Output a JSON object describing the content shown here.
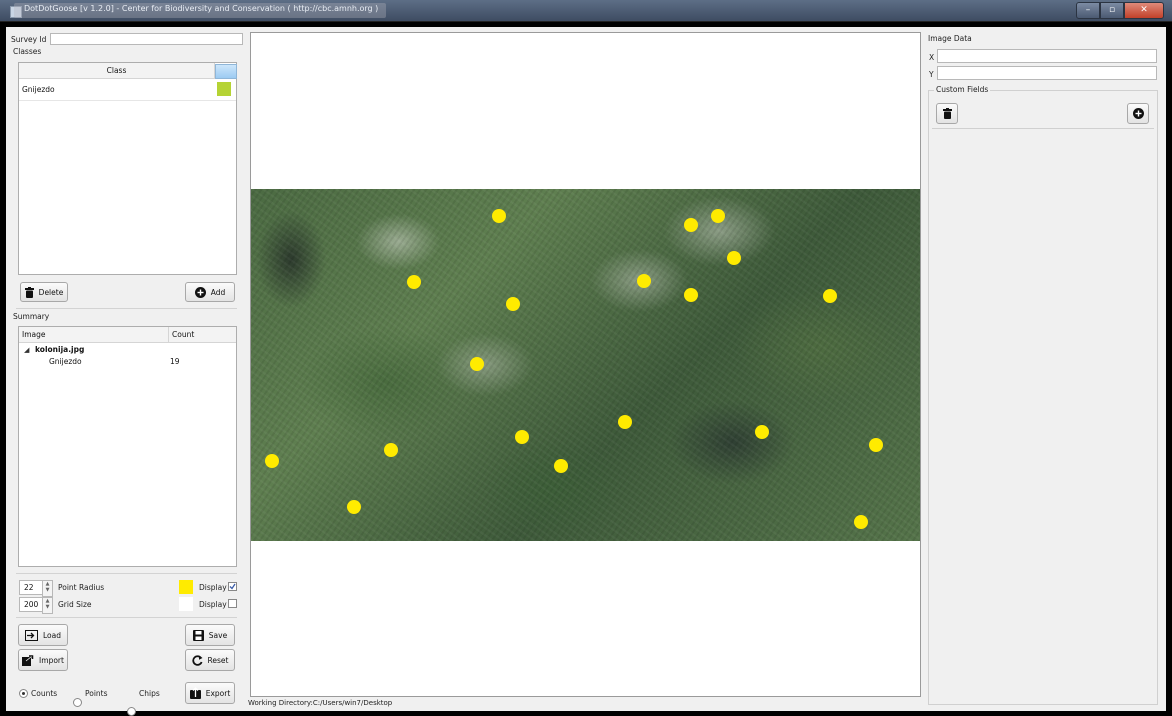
{
  "window": {
    "title": "DotDotGoose [v 1.2.0] - Center for Biodiversity and Conservation ( http://cbc.amnh.org )"
  },
  "left": {
    "survey_id_label": "Survey Id",
    "survey_id_value": "",
    "classes_label": "Classes",
    "classes_table": {
      "header": "Class",
      "rows": [
        {
          "name": "Gnijezdo",
          "color": "#b5d334"
        }
      ]
    },
    "delete_label": "Delete",
    "add_label": "Add",
    "summary_label": "Summary",
    "summary_table": {
      "headers": [
        "Image",
        "Count"
      ],
      "image_name": "kolonija.jpg",
      "rows": [
        {
          "class": "Gnijezdo",
          "count": "19"
        }
      ]
    },
    "point_radius_value": "22",
    "point_radius_label": "Point Radius",
    "point_color": "#ffeb00",
    "grid_size_value": "200",
    "grid_size_label": "Grid Size",
    "grid_color": "#ffffff",
    "display_label": "Display",
    "point_display_checked": true,
    "grid_display_checked": false,
    "load_label": "Load",
    "save_label": "Save",
    "import_label": "Import",
    "reset_label": "Reset",
    "export_label": "Export",
    "radio_options": [
      "Counts",
      "Points",
      "Chips"
    ],
    "radio_selected": "Counts"
  },
  "right": {
    "image_data_label": "Image Data",
    "x_label": "X",
    "y_label": "Y",
    "x_value": "",
    "y_value": "",
    "custom_fields_label": "Custom Fields"
  },
  "canvas": {
    "image_file": "kolonija.jpg",
    "point_count": 19
  },
  "status": {
    "working_directory": "Working Directory:C:/Users/win7/Desktop"
  }
}
